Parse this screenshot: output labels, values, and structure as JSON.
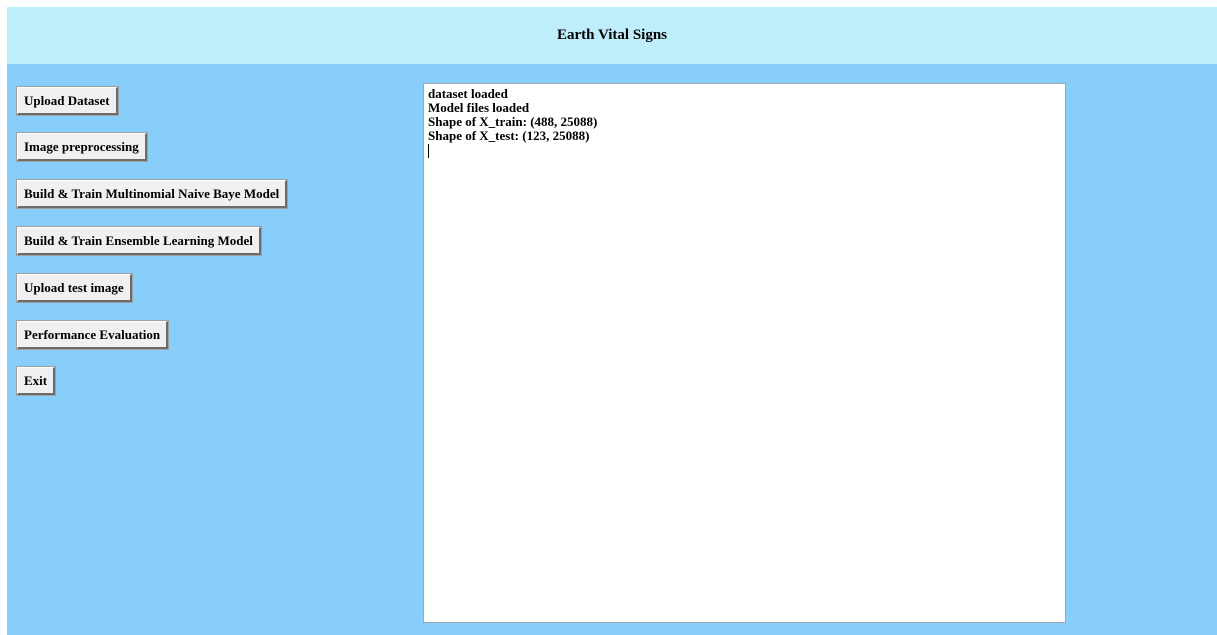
{
  "window": {
    "title": "Earth Vital Signs"
  },
  "buttons": {
    "upload_dataset": "Upload Dataset",
    "image_preprocessing": "Image preprocessing",
    "build_nb": "Build & Train Multinomial Naive Baye Model",
    "build_ensemble": "Build & Train Ensemble Learning Model",
    "upload_test_image": "Upload test image",
    "performance_evaluation": "Performance Evaluation",
    "exit": "Exit"
  },
  "output": {
    "lines": [
      "dataset loaded",
      "Model files loaded",
      "Shape of X_train: (488, 25088)",
      "Shape of X_test: (123, 25088)"
    ]
  },
  "colors": {
    "window_background": "#87cefa",
    "title_background": "#bfeefb",
    "button_background": "#f0f0f0",
    "text_area_background": "#ffffff"
  }
}
